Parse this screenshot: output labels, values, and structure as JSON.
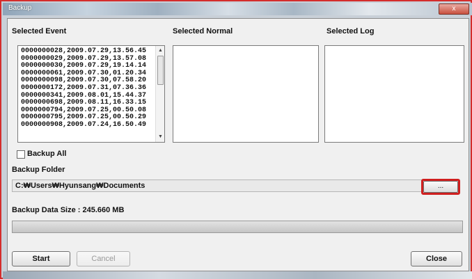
{
  "window": {
    "title": "Backup",
    "close_glyph": "x"
  },
  "lists": {
    "event_label": "Selected Event",
    "normal_label": "Selected Normal",
    "log_label": "Selected Log",
    "events": [
      "0000000028,2009.07.29,13.56.45",
      "0000000029,2009.07.29,13.57.08",
      "0000000030,2009.07.29,19.14.14",
      "0000000061,2009.07.30,01.20.34",
      "0000000098,2009.07.30,07.58.20",
      "0000000172,2009.07.31,07.36.36",
      "0000000341,2009.08.01,15.44.37",
      "0000000698,2009.08.11,16.33.15",
      "0000000794,2009.07.25,00.50.08",
      "0000000795,2009.07.25,00.50.29",
      "0000000908,2009.07.24,16.50.49"
    ]
  },
  "backup_all": {
    "label": "Backup All",
    "checked": false
  },
  "folder": {
    "label": "Backup Folder",
    "path": "C:₩Users₩Hyunsang₩Documents",
    "browse_label": "..."
  },
  "data_size": {
    "label": "Backup Data Size : 245.660 MB"
  },
  "progress": {
    "fraction": 0.0
  },
  "buttons": {
    "start": "Start",
    "cancel": "Cancel",
    "close": "Close"
  },
  "colors": {
    "highlight": "#cf1f1f",
    "accent": "#5bc15a"
  }
}
